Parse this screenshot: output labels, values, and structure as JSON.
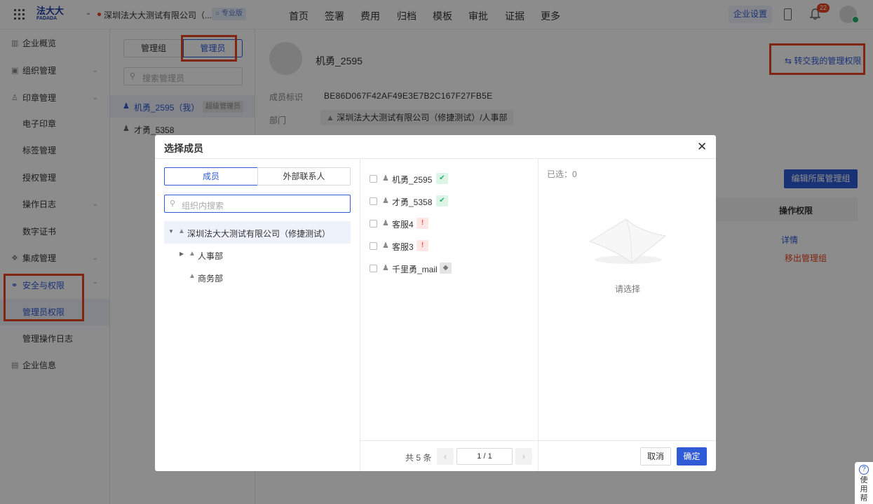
{
  "topbar": {
    "logo_cn": "法大大",
    "logo_en": "FADADA",
    "company": "深圳法大大测试有限公司（...",
    "edition": "专业版",
    "nav": [
      "首页",
      "签署",
      "费用",
      "归档",
      "模板",
      "审批",
      "证据",
      "更多"
    ],
    "settings_btn": "企业设置",
    "notif_count": "22"
  },
  "sidebar": {
    "items": [
      {
        "label": "企业概览",
        "icon": "overview-icon"
      },
      {
        "label": "组织管理",
        "icon": "org-icon"
      },
      {
        "label": "印章管理",
        "icon": "seal-icon"
      },
      {
        "label": "电子印章"
      },
      {
        "label": "标签管理"
      },
      {
        "label": "授权管理"
      },
      {
        "label": "操作日志"
      },
      {
        "label": "数字证书"
      },
      {
        "label": "集成管理",
        "icon": "integration-icon"
      },
      {
        "label": "安全与权限",
        "icon": "security-icon"
      },
      {
        "label": "管理员权限"
      },
      {
        "label": "管理操作日志"
      },
      {
        "label": "企业信息",
        "icon": "info-icon"
      }
    ]
  },
  "panel2": {
    "tab_group": "管理组",
    "tab_admin": "管理员",
    "search_placeholder": "搜索管理员",
    "admins": [
      {
        "name": "机勇_2595",
        "suffix": "（我）",
        "badge": "超级管理员"
      },
      {
        "name": "才勇_5358"
      }
    ]
  },
  "main": {
    "name": "机勇_2595",
    "transfer": "转交我的管理权限",
    "id_label": "成员标识",
    "id_value": "BE86D067F42AF49E3E7B2C167F27FB5E",
    "dept_label": "部门",
    "dept_value": "深圳法大大测试有限公司（修捷测试）/人事部",
    "edit_group_btn": "编辑所属管理组",
    "col_perm": "操作权限",
    "detail_link": "详情",
    "remove_link": "移出管理组"
  },
  "modal": {
    "title": "选择成员",
    "tab_member": "成员",
    "tab_external": "外部联系人",
    "search_placeholder": "组织内搜索",
    "tree": {
      "root": "深圳法大大测试有限公司（修捷测试）",
      "children": [
        "人事部",
        "商务部"
      ]
    },
    "members": [
      {
        "name": "机勇_2595",
        "status": "verified"
      },
      {
        "name": "才勇_5358",
        "status": "verified"
      },
      {
        "name": "客服4",
        "status": "unverified"
      },
      {
        "name": "客服3",
        "status": "unverified"
      },
      {
        "name": "千里勇_mail",
        "status": "pending"
      }
    ],
    "total": "共 5 条",
    "page": "1 / 1",
    "selected_label": "已选：0",
    "empty_text": "请选择",
    "cancel": "取消",
    "confirm": "确定"
  },
  "help": "使用帮",
  "colors": {
    "accent": "#2f5bd6",
    "danger": "#e8441f",
    "verified": "#22b36b",
    "unverified": "#f05a4a"
  }
}
